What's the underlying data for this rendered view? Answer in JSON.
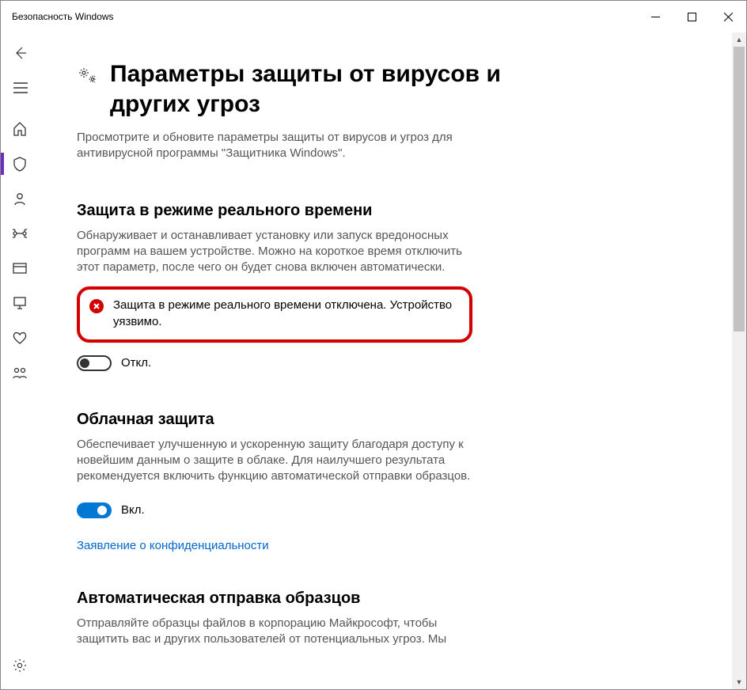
{
  "window": {
    "title": "Безопасность Windows"
  },
  "page": {
    "title": "Параметры защиты от вирусов и других угроз",
    "intro": "Просмотрите и обновите параметры защиты от вирусов и угроз для антивирусной программы \"Защитника Windows\"."
  },
  "realtime": {
    "heading": "Защита в режиме реального времени",
    "desc": "Обнаруживает и останавливает установку или запуск вредоносных программ на вашем устройстве. Можно на короткое время отключить этот параметр, после чего он будет снова включен автоматически.",
    "warning": "Защита в режиме реального времени отключена. Устройство уязвимо.",
    "toggle_label": "Откл."
  },
  "cloud": {
    "heading": "Облачная защита",
    "desc": "Обеспечивает улучшенную и ускоренную защиту благодаря доступу к новейшим данным о защите в облаке. Для наилучшего результата рекомендуется включить функцию автоматической отправки образцов.",
    "toggle_label": "Вкл.",
    "privacy_link": "Заявление о конфиденциальности"
  },
  "autosubmit": {
    "heading": "Автоматическая отправка образцов",
    "desc": "Отправляйте образцы файлов в корпорацию Майкрософт, чтобы защитить вас и других пользователей от потенциальных угроз. Мы"
  }
}
